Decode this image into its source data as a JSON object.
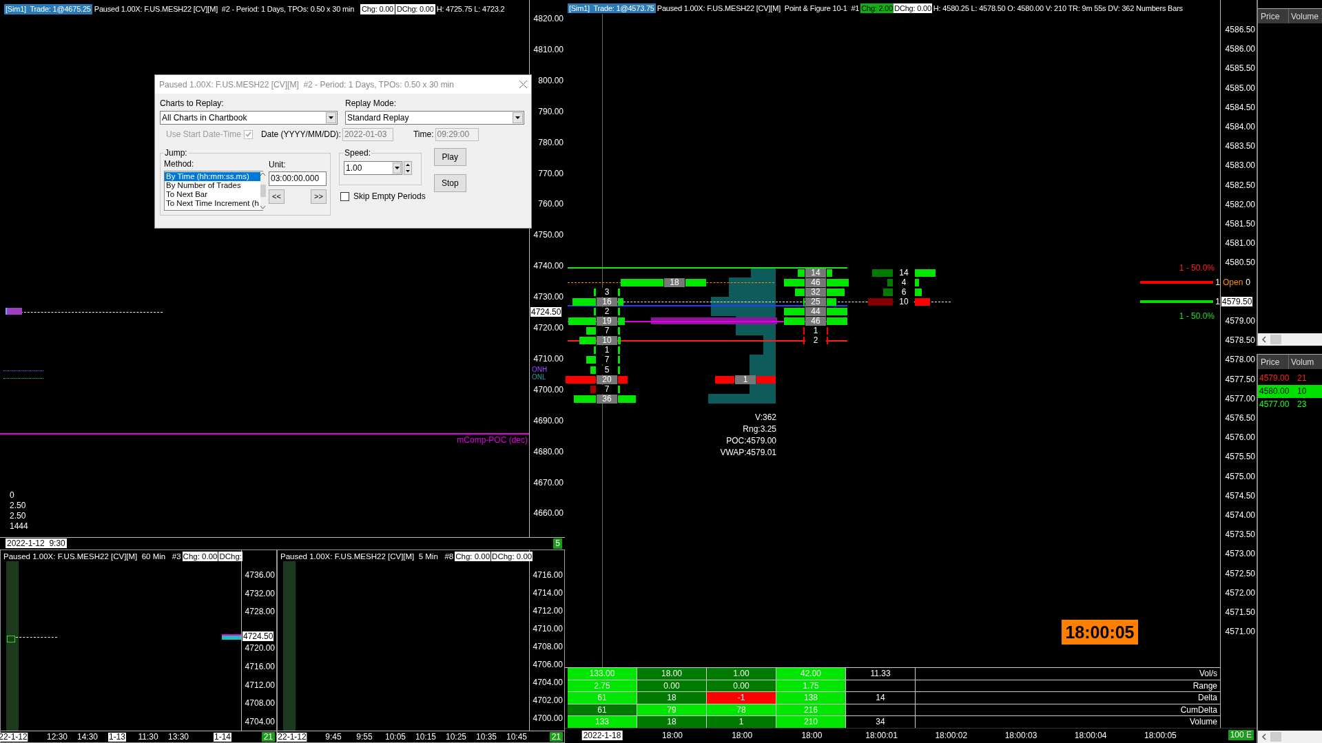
{
  "top_chart": {
    "header": {
      "account": "[Sim1]  Trade: 1@4675.25",
      "title": "Paused 1.00X: F.US.MESH22 [CV][M]  #2 - Period: 1 Days, TPOs: 0.50 x 30 min",
      "chg": "Chg: 0.00",
      "dchg": "DChg: 0.00",
      "high_low": "H: 4725.75 L: 4723.2"
    },
    "price_axis": [
      "4820.00",
      "4810.00",
      "800.00",
      "790.00",
      "780.00",
      "770.00",
      "760.00",
      "4750.00",
      "4740.00",
      "4730.00",
      "4720.00",
      "4710.00",
      "4700.00",
      "4690.00",
      "4680.00",
      "4670.00",
      "4660.00"
    ],
    "price_marker": "4724.50",
    "level_labels": [
      "ONH",
      "ONL"
    ],
    "poc_label": "mComp-POC (dec)",
    "stats": [
      "0",
      "2.50",
      "2.50",
      "1444"
    ],
    "date_label": "2022-1-12  9:30",
    "counter": "5"
  },
  "replay_dialog": {
    "title": "Paused 1.00X: F.US.MESH22 [CV][M]  #2 - Period: 1 Days, TPOs: 0.50 x 30 min",
    "charts_label": "Charts to Replay:",
    "charts_value": "All Charts in Chartbook",
    "mode_label": "Replay Mode:",
    "mode_value": "Standard Replay",
    "use_start": {
      "label": "Use Start Date-Time",
      "checked": true,
      "disabled": true
    },
    "date_label": "Date (YYYY/MM/DD):",
    "date_field": {
      "value": "2022-01-03",
      "disabled": true
    },
    "time_label": "Time:",
    "time_field": {
      "value": "09:29:00",
      "disabled": true
    },
    "jump_label": "Jump:",
    "method_label": "Method:",
    "methods": [
      {
        "label": "By Time (hh:mm:ss.ms)",
        "selected": true
      },
      {
        "label": "By Number of Trades",
        "selected": false
      },
      {
        "label": "To Next Bar",
        "selected": false
      },
      {
        "label": "To Next Time Increment (h",
        "selected": false
      }
    ],
    "unit_label": "Unit:",
    "unit_value": "03:00:00.000",
    "back_button": "<<",
    "forward_button": ">>",
    "speed_label": "Speed:",
    "speed_value": "1.00",
    "skip_empty": {
      "label": "Skip Empty Periods",
      "checked": false
    },
    "play_button": "Play",
    "stop_button": "Stop"
  },
  "main_chart": {
    "header": {
      "account": "[Sim1]  Trade: 1@4573.75",
      "title": "Paused 1.00X: F.US.MESH22 [CV][M]  Point & Figure 10-1  #1",
      "chg": "Chg: 2.00",
      "dchg": "DChg: 0.00",
      "details": "H: 4580.25 L: 4578.50 O: 4580.00 V: 210 TR: 9m 55s DV: 362 Numbers Bars"
    },
    "price_axis": [
      "4586.50",
      "4586.00",
      "4585.50",
      "4585.00",
      "4584.50",
      "4584.00",
      "4583.50",
      "4583.00",
      "4582.50",
      "4582.00",
      "4581.50",
      "4581.00",
      "4580.50",
      "4579.00",
      "4578.50",
      "4578.00",
      "4577.50",
      "4577.00",
      "4576.50",
      "4576.00",
      "4575.50",
      "4575.00",
      "4574.50",
      "4574.00",
      "4573.50",
      "4573.00",
      "4572.50",
      "4572.00",
      "4571.50",
      "4571.00"
    ],
    "footprint": [
      {
        "cells": [
          {
            "text": "3",
            "highlighted": false
          },
          {
            "text": "16",
            "highlighted": true
          },
          {
            "text": "2",
            "highlighted": false
          },
          {
            "text": "19",
            "highlighted": true
          },
          {
            "text": "7",
            "highlighted": false
          },
          {
            "text": "10",
            "highlighted": true
          },
          {
            "text": "1",
            "highlighted": false
          },
          {
            "text": "7",
            "highlighted": false
          },
          {
            "text": "5",
            "highlighted": false
          },
          {
            "text": "20",
            "highlighted": true
          },
          {
            "text": "7",
            "highlighted": false
          },
          {
            "text": "36",
            "highlighted": true
          }
        ]
      },
      {
        "cells": [
          {
            "text": "18",
            "highlighted": true
          },
          {
            "text": "1",
            "highlighted": true
          }
        ]
      },
      {
        "cells": [
          {
            "text": "14",
            "highlighted": true
          },
          {
            "text": "46",
            "highlighted": true
          },
          {
            "text": "32",
            "highlighted": true
          },
          {
            "text": "25",
            "highlighted": true
          },
          {
            "text": "44",
            "highlighted": true
          },
          {
            "text": "46",
            "highlighted": true
          },
          {
            "text": "1",
            "highlighted": false
          },
          {
            "text": "2",
            "highlighted": false
          }
        ]
      },
      {
        "cells": [
          {
            "text": "14",
            "highlighted": false
          },
          {
            "text": "4",
            "highlighted": false
          },
          {
            "text": "6",
            "highlighted": false
          },
          {
            "text": "10",
            "highlighted": false
          }
        ]
      }
    ],
    "bar_stats": [
      "V:362",
      "Rng:3.25",
      "POC:4579.00",
      "VWAP:4579.01"
    ],
    "order_markers": {
      "upper": "1 - 50.0%",
      "qty_upper": "1",
      "open_label": "Open",
      "open_value": "0",
      "qty_lower": "1",
      "lower": "1 - 50.0%"
    },
    "price_marker": "4579.50",
    "clock": "18:00:05",
    "stats_table": [
      {
        "label": "Vol/s",
        "cells": [
          {
            "text": "133.00",
            "color": "#00e600"
          },
          {
            "text": "18.00",
            "color": "#007a00"
          },
          {
            "text": "1.00",
            "color": "#007a00"
          },
          {
            "text": "42.00",
            "color": "#00e600"
          },
          {
            "text": "11.33",
            "color": "#000000"
          }
        ]
      },
      {
        "label": "Range",
        "cells": [
          {
            "text": "2.75",
            "color": "#00e600"
          },
          {
            "text": "0.00",
            "color": "#007a00"
          },
          {
            "text": "0.00",
            "color": "#007a00"
          },
          {
            "text": "1.75",
            "color": "#00e600"
          },
          {
            "color": "#000000"
          }
        ]
      },
      {
        "label": "Delta",
        "cells": [
          {
            "text": "61",
            "color": "#00e600"
          },
          {
            "text": "18",
            "color": "#007a00"
          },
          {
            "text": "-1",
            "color": "#ff0000"
          },
          {
            "text": "138",
            "color": "#00e600"
          },
          {
            "text": "14",
            "color": "#000000"
          }
        ]
      },
      {
        "label": "CumDelta",
        "cells": [
          {
            "text": "61",
            "color": "#007a00"
          },
          {
            "text": "79",
            "color": "#00e600"
          },
          {
            "text": "78",
            "color": "#00e600"
          },
          {
            "text": "216",
            "color": "#00e600"
          },
          {
            "color": "#000000"
          }
        ]
      },
      {
        "label": "Volume",
        "cells": [
          {
            "text": "133",
            "color": "#00e600"
          },
          {
            "text": "18",
            "color": "#007a00"
          },
          {
            "text": "1",
            "color": "#007a00"
          },
          {
            "text": "210",
            "color": "#00e600"
          },
          {
            "text": "34",
            "color": "#000000"
          }
        ]
      }
    ],
    "time_axis": {
      "date": "2022-1-18",
      "times": [
        "18:00",
        "18:00",
        "18:00",
        "18:00:01",
        "18:00:02",
        "18:00:03",
        "18:00:04",
        "18:00:05"
      ],
      "counter": "100 E"
    }
  },
  "bottom_charts": [
    {
      "title": "Paused 1.00X: F.US.MESH22 [CV][M]  60 Min   #3",
      "chg": "Chg: 0.00",
      "dchg": "DChg:",
      "price_axis": [
        "4736.00",
        "4732.00",
        "4728.00",
        "4720.00",
        "4716.00",
        "4712.00",
        "4708.00",
        "4704.00"
      ],
      "price_marker": "4724.50",
      "x_labels": [
        {
          "text": "22-1-12",
          "kind": "date"
        },
        {
          "text": "12:30",
          "kind": "time"
        },
        {
          "text": "14:30",
          "kind": "time"
        },
        {
          "text": "1-13",
          "kind": "date"
        },
        {
          "text": "11:30",
          "kind": "time"
        },
        {
          "text": "13:30",
          "kind": "time"
        },
        {
          "text": "1-14",
          "kind": "date"
        }
      ],
      "counter": "21"
    },
    {
      "title": "Paused 1.00X: F.US.MESH22 [CV][M]  5 Min   #8",
      "chg": "Chg: 0.00",
      "dchg": "DChg: 0.00",
      "price_axis": [
        "4716.00",
        "4714.00",
        "4712.00",
        "4710.00",
        "4708.00",
        "4706.00",
        "4704.00",
        "4702.00",
        "4700.00"
      ],
      "x_labels": [
        {
          "text": "22-1-12",
          "kind": "date"
        },
        {
          "text": "9:45",
          "kind": "time"
        },
        {
          "text": "9:55",
          "kind": "time"
        },
        {
          "text": "10:05",
          "kind": "time"
        },
        {
          "text": "10:15",
          "kind": "time"
        },
        {
          "text": "10:25",
          "kind": "time"
        },
        {
          "text": "10:35",
          "kind": "time"
        },
        {
          "text": "10:45",
          "kind": "time"
        }
      ],
      "counter": "21"
    }
  ],
  "dom_panels": [
    {
      "columns": [
        "Price",
        "Volume"
      ]
    },
    {
      "columns": [
        "Price",
        "Volum"
      ],
      "rows": [
        {
          "price": "4579.00",
          "volume": "21",
          "kind": "sell",
          "highlighted": false
        },
        {
          "price": "4580.00",
          "volume": "10",
          "kind": "buy",
          "highlighted": true
        },
        {
          "price": "4577.00",
          "volume": "23",
          "kind": "buy",
          "highlighted": false
        }
      ]
    }
  ]
}
